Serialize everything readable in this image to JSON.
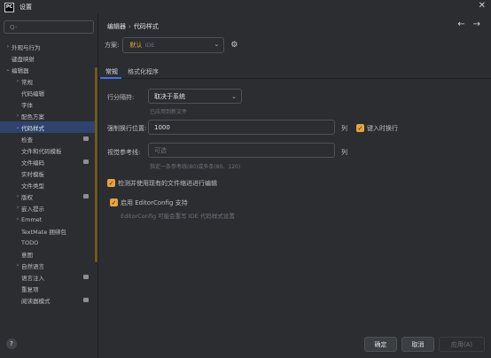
{
  "window": {
    "title": "设置",
    "app_icon": "PC"
  },
  "search": {
    "placeholder": "Q-"
  },
  "sidebar": {
    "items": [
      {
        "label": "外观与行为",
        "chevron": "›"
      },
      {
        "label": "键盘映射",
        "chevron": ""
      },
      {
        "label": "编辑器",
        "chevron": "⌄"
      },
      {
        "label": "常规",
        "chevron": "›"
      },
      {
        "label": "代码编辑",
        "chevron": ""
      },
      {
        "label": "字体",
        "chevron": ""
      },
      {
        "label": "配色方案",
        "chevron": "›"
      },
      {
        "label": "代码样式",
        "chevron": "⌄"
      },
      {
        "label": "检查",
        "chevron": ""
      },
      {
        "label": "文件和代码模板",
        "chevron": ""
      },
      {
        "label": "文件编码",
        "chevron": ""
      },
      {
        "label": "实时模板",
        "chevron": ""
      },
      {
        "label": "文件类型",
        "chevron": ""
      },
      {
        "label": "版权",
        "chevron": "›"
      },
      {
        "label": "嵌入提示",
        "chevron": "›"
      },
      {
        "label": "Emmet",
        "chevron": "›"
      },
      {
        "label": "TextMate 捆绑包",
        "chevron": ""
      },
      {
        "label": "TODO",
        "chevron": ""
      },
      {
        "label": "意图",
        "chevron": ""
      },
      {
        "label": "自然语言",
        "chevron": "›"
      },
      {
        "label": "语言注入",
        "chevron": ""
      },
      {
        "label": "重复项",
        "chevron": ""
      },
      {
        "label": "阅读器模式",
        "chevron": ""
      }
    ]
  },
  "breadcrumb": {
    "parent": "编辑器",
    "separator": "›",
    "current": "代码样式"
  },
  "nav": {
    "back": "←",
    "forward": "→"
  },
  "scheme": {
    "label": "方案:",
    "value": "默认",
    "sub": "IDE",
    "caret": "⌄",
    "gear_icon": "⚙"
  },
  "tabs": {
    "general": "常规",
    "formatter": "格式化程序"
  },
  "line_sep": {
    "label": "行分隔符:",
    "value": "取决于系统",
    "caret": "⌄",
    "hint": "已应用到新文件"
  },
  "hard_wrap": {
    "label": "强制换行位置:",
    "value": "1000",
    "unit": "列",
    "checkbox_label": "键入时换行"
  },
  "visual_guides": {
    "label": "视觉参考线:",
    "placeholder": "可选",
    "unit": "列",
    "hint": "指定一条参考线(80)或多条(80、120)"
  },
  "detect_indent": {
    "label": "检测并使用现有的文件缩进进行编辑"
  },
  "editorconfig": {
    "label": "启用 EditorConfig 支持",
    "hint": "EditorConfig 可能会重写 IDE 代码样式设置"
  },
  "footer": {
    "help": "?",
    "ok": "确定",
    "cancel": "取消",
    "apply": "应用(A)"
  },
  "colors": {
    "accent": "#e8a33e",
    "selection": "#2e436e",
    "bg": "#2b2d30"
  }
}
